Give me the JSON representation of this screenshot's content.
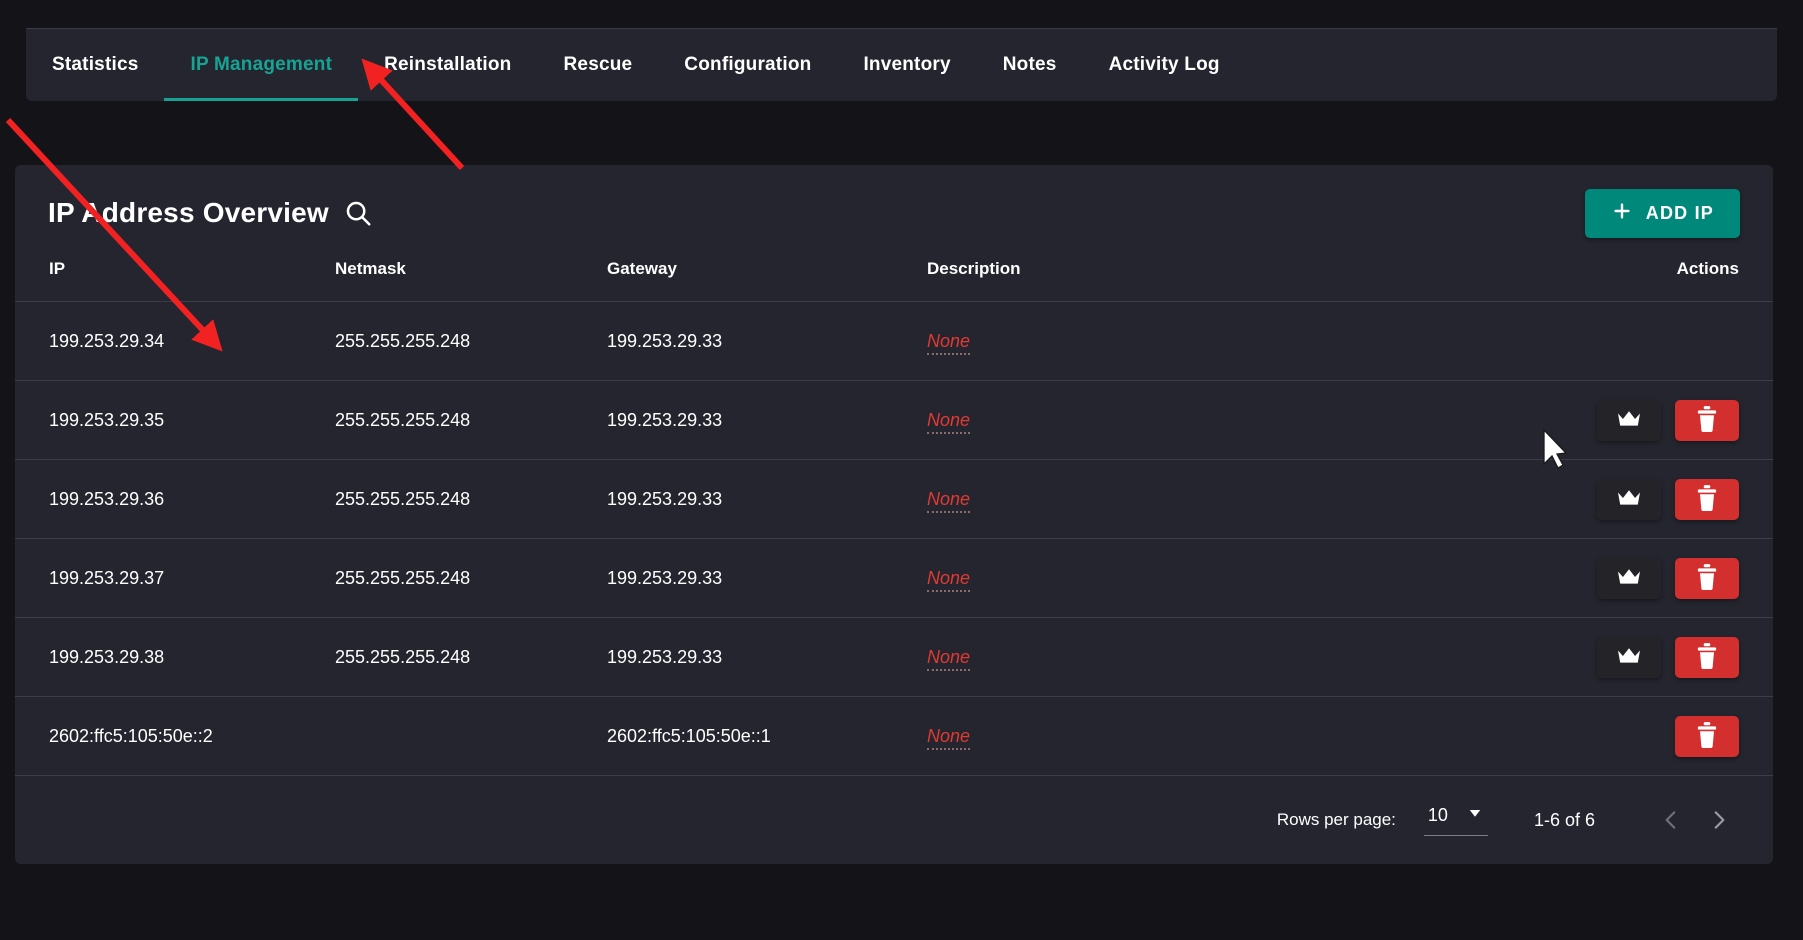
{
  "tabs": [
    {
      "label": "Statistics",
      "active": false
    },
    {
      "label": "IP Management",
      "active": true
    },
    {
      "label": "Reinstallation",
      "active": false
    },
    {
      "label": "Rescue",
      "active": false
    },
    {
      "label": "Configuration",
      "active": false
    },
    {
      "label": "Inventory",
      "active": false
    },
    {
      "label": "Notes",
      "active": false
    },
    {
      "label": "Activity Log",
      "active": false
    }
  ],
  "card": {
    "title": "IP Address Overview",
    "search_icon": "search-icon",
    "add_button": {
      "label": "ADD IP",
      "icon": "plus-icon",
      "color": "#00897b"
    }
  },
  "table": {
    "headers": {
      "ip": "IP",
      "netmask": "Netmask",
      "gateway": "Gateway",
      "description": "Description",
      "actions": "Actions"
    },
    "rows": [
      {
        "ip": "199.253.29.34",
        "netmask": "255.255.255.248",
        "gateway": "199.253.29.33",
        "description": "None",
        "has_crown": false,
        "has_delete": false
      },
      {
        "ip": "199.253.29.35",
        "netmask": "255.255.255.248",
        "gateway": "199.253.29.33",
        "description": "None",
        "has_crown": true,
        "has_delete": true
      },
      {
        "ip": "199.253.29.36",
        "netmask": "255.255.255.248",
        "gateway": "199.253.29.33",
        "description": "None",
        "has_crown": true,
        "has_delete": true
      },
      {
        "ip": "199.253.29.37",
        "netmask": "255.255.255.248",
        "gateway": "199.253.29.33",
        "description": "None",
        "has_crown": true,
        "has_delete": true
      },
      {
        "ip": "199.253.29.38",
        "netmask": "255.255.255.248",
        "gateway": "199.253.29.33",
        "description": "None",
        "has_crown": true,
        "has_delete": true
      },
      {
        "ip": "2602:ffc5:105:50e::2",
        "netmask": "",
        "gateway": "2602:ffc5:105:50e::1",
        "description": "None",
        "has_crown": false,
        "has_delete": true
      }
    ]
  },
  "pagination": {
    "rows_per_page_label": "Rows per page:",
    "rows_per_page_value": "10",
    "range": "1-6 of 6",
    "prev_icon": "chevron-left-icon",
    "next_icon": "chevron-right-icon"
  },
  "colors": {
    "page_bg": "#131318",
    "card_bg": "#24252e",
    "accent": "#16a394",
    "add_button": "#00897b",
    "delete": "#d32f2f",
    "none_text": "#e03a33",
    "annotation": "#f22222"
  },
  "annotations": [
    {
      "name": "arrow-to-ip-management-tab"
    },
    {
      "name": "arrow-to-first-ip-row"
    }
  ]
}
